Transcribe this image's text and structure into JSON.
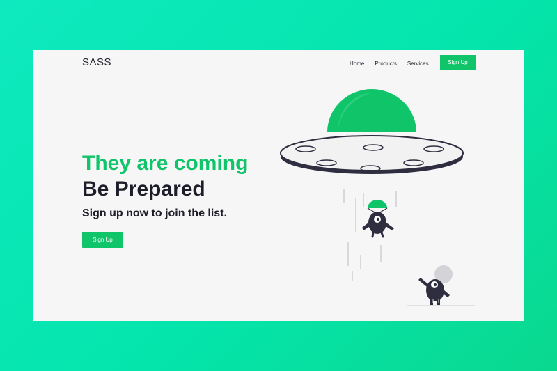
{
  "nav": {
    "brand": "SASS",
    "links": [
      {
        "label": "Home"
      },
      {
        "label": "Products"
      },
      {
        "label": "Services"
      }
    ],
    "cta_label": "Sign Up"
  },
  "hero": {
    "title": "They are coming",
    "subtitle": "Be Prepared",
    "tagline": "Sign up now to join the list.",
    "cta_label": "Sign Up"
  },
  "illustration": {
    "icons": [
      "ufo-icon",
      "alien-falling-icon",
      "alien-standing-icon"
    ],
    "colors": {
      "accent": "#10c46a",
      "dark": "#2f2e41",
      "background": "#f6f6f7"
    }
  }
}
